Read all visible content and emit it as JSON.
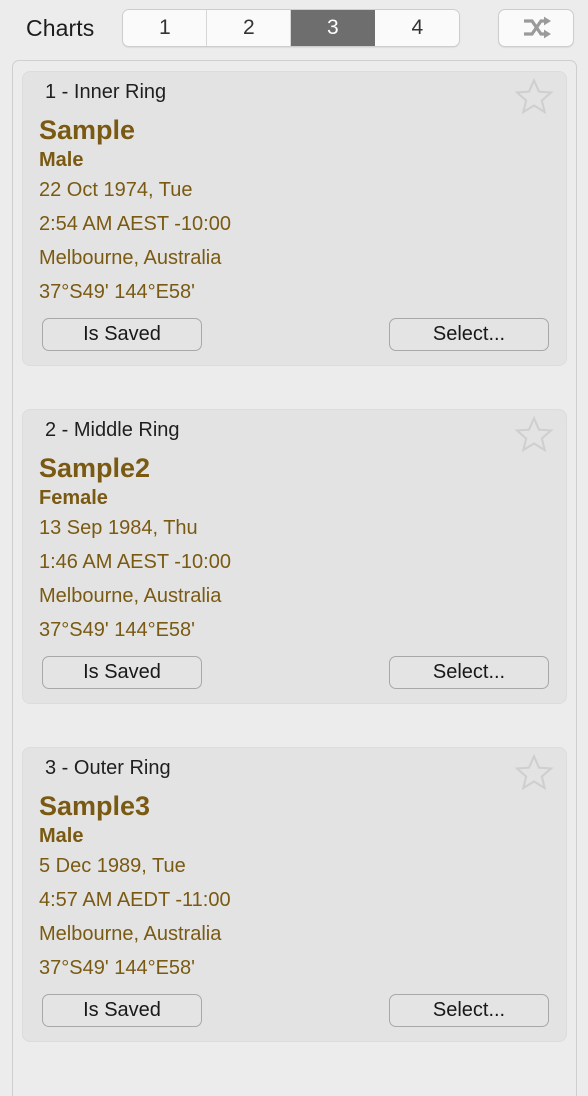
{
  "header": {
    "title": "Charts",
    "segments": [
      {
        "label": "1",
        "selected": false
      },
      {
        "label": "2",
        "selected": false
      },
      {
        "label": "3",
        "selected": true
      },
      {
        "label": "4",
        "selected": false
      }
    ],
    "shuffle_icon": "shuffle-icon",
    "selected_segment": "3",
    "colors": {
      "selected_background": "#6e6e6e",
      "selected_text": "#ffffff",
      "segment_background": "#fafafa",
      "bar_background": "#ececec"
    }
  },
  "colors": {
    "accent_text": "#7a5a12",
    "card_background": "#e3e3e3",
    "panel_background": "#ececec",
    "star_outline": "#cfcfcf",
    "button_background": "#e4e4e4",
    "button_border": "#a8a8a8"
  },
  "cards": [
    {
      "index_label": "1 - Inner Ring",
      "name": "Sample",
      "sex": "Male",
      "date": "22 Oct 1974, Tue",
      "time": "2:54 AM AEST -10:00",
      "place": "Melbourne, Australia",
      "coordinates": "37°S49' 144°E58'",
      "saved_button": "Is Saved",
      "select_button": "Select...",
      "star_icon": "star-outline-icon",
      "starred": false
    },
    {
      "index_label": "2 - Middle Ring",
      "name": "Sample2",
      "sex": "Female",
      "date": "13 Sep 1984, Thu",
      "time": "1:46 AM AEST -10:00",
      "place": "Melbourne, Australia",
      "coordinates": "37°S49' 144°E58'",
      "saved_button": "Is Saved",
      "select_button": "Select...",
      "star_icon": "star-outline-icon",
      "starred": false
    },
    {
      "index_label": "3 - Outer Ring",
      "name": "Sample3",
      "sex": "Male",
      "date": "5 Dec 1989, Tue",
      "time": "4:57 AM AEDT -11:00",
      "place": "Melbourne, Australia",
      "coordinates": "37°S49' 144°E58'",
      "saved_button": "Is Saved",
      "select_button": "Select...",
      "star_icon": "star-outline-icon",
      "starred": false
    }
  ]
}
